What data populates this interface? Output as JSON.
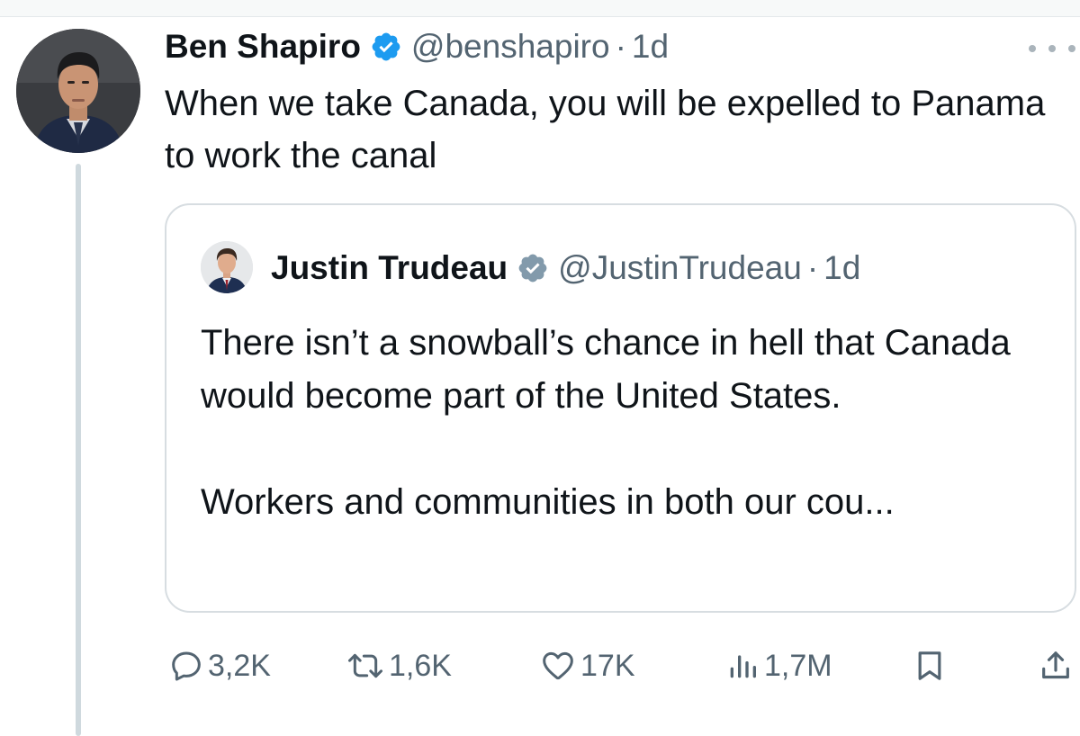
{
  "tweet": {
    "author_name": "Ben Shapiro",
    "handle": "@benshapiro",
    "separator": "·",
    "time": "1d",
    "text": "When we take Canada, you will be expelled to Panama to work the canal"
  },
  "quote": {
    "author_name": "Justin Trudeau",
    "handle": "@JustinTrudeau",
    "separator": "·",
    "time": "1d",
    "paragraph_1": "There isn’t a snowball’s chance in hell that Canada would become part of the United States.",
    "paragraph_2": "Workers and communities in both our cou..."
  },
  "actions": {
    "replies": "3,2K",
    "reposts": "1,6K",
    "likes": "17K",
    "views": "1,7M"
  },
  "icons": {
    "verified": "verified-badge-icon",
    "more": "more-options-icon",
    "reply": "reply-icon",
    "repost": "repost-icon",
    "like": "heart-icon",
    "views": "views-icon",
    "bookmark": "bookmark-icon",
    "share": "share-icon"
  },
  "colors": {
    "verified_blue": "#1d9bf0",
    "verified_gray": "#829aab",
    "text_primary": "#0f1419",
    "text_secondary": "#536471"
  }
}
